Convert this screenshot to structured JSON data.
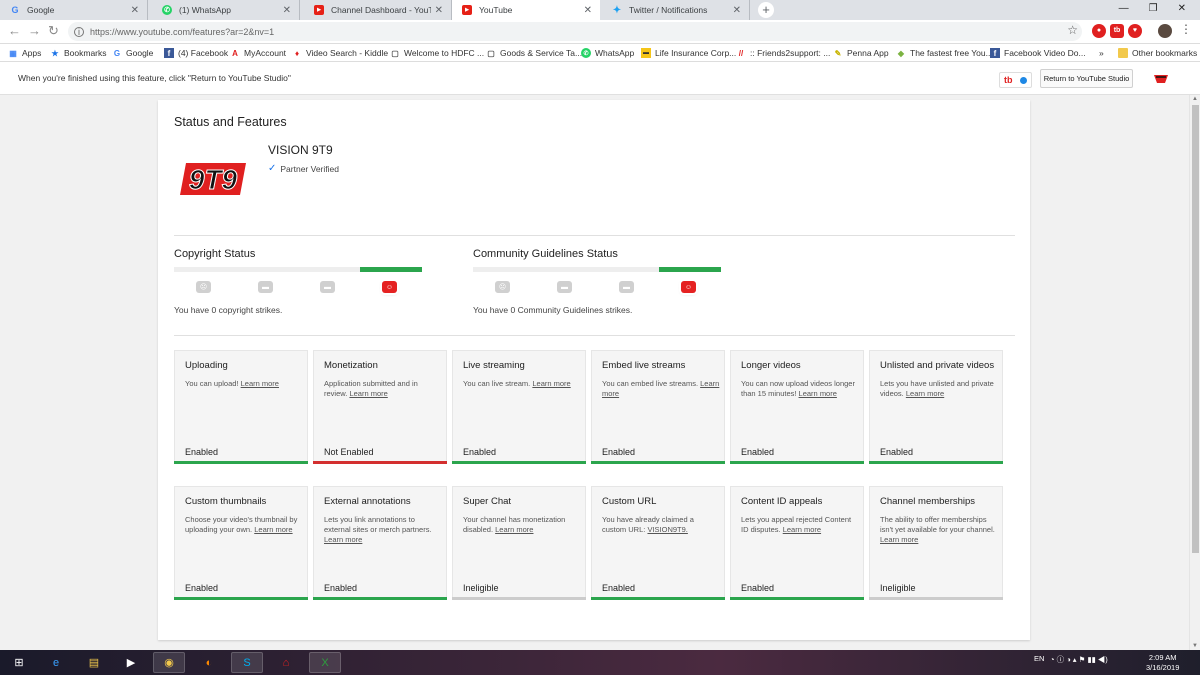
{
  "tabs": [
    {
      "title": "Google",
      "icon": "google-icon"
    },
    {
      "title": "(1) WhatsApp",
      "icon": "whatsapp-icon"
    },
    {
      "title": "Channel Dashboard - YouTube S",
      "icon": "youtube-icon"
    },
    {
      "title": "YouTube",
      "icon": "youtube-icon"
    },
    {
      "title": "Twitter / Notifications",
      "icon": "twitter-icon"
    }
  ],
  "address": {
    "url": "https://www.youtube.com/features?ar=2&nv=1"
  },
  "bookmarks": [
    "Apps",
    "Bookmarks",
    "Google",
    "(4) Facebook",
    "MyAccount",
    "Video Search - Kiddle",
    "Welcome to HDFC ...",
    "Goods & Service Ta...",
    "WhatsApp",
    "Life Insurance Corp...",
    ":: Friends2support: ...",
    "Penna App",
    "The fastest free You...",
    "Facebook Video Do..."
  ],
  "bookmarks_more": "»",
  "other_bookmarks": "Other bookmarks",
  "notice": {
    "message": "When you're finished using this feature, click \"Return to YouTube Studio\"",
    "return_label": "Return to YouTube Studio",
    "tb_label": "tb"
  },
  "page": {
    "title": "Status and Features",
    "channel_name": "VISION 9T9",
    "verified": "Partner Verified",
    "copyright": {
      "title": "Copyright Status",
      "text": "You have 0 copyright strikes.",
      "level": 0
    },
    "community": {
      "title": "Community Guidelines Status",
      "text": "You have 0 Community Guidelines strikes.",
      "level": 0
    }
  },
  "features": [
    {
      "title": "Uploading",
      "desc": "You can upload!",
      "link": "Learn more",
      "status": "Enabled",
      "color": "#2ba54d"
    },
    {
      "title": "Monetization",
      "desc": "Application submitted and in review.",
      "link": "Learn more",
      "status": "Not Enabled",
      "color": "#d32f2f"
    },
    {
      "title": "Live streaming",
      "desc": "You can live stream.",
      "link": "Learn more",
      "status": "Enabled",
      "color": "#2ba54d"
    },
    {
      "title": "Embed live streams",
      "desc": "You can embed live streams.",
      "link": "Learn more",
      "status": "Enabled",
      "color": "#2ba54d"
    },
    {
      "title": "Longer videos",
      "desc": "You can now upload videos longer than 15 minutes!",
      "link": "Learn more",
      "status": "Enabled",
      "color": "#2ba54d"
    },
    {
      "title": "Unlisted and private videos",
      "desc": "Lets you have unlisted and private videos.",
      "link": "Learn more",
      "status": "Enabled",
      "color": "#2ba54d"
    },
    {
      "title": "Custom thumbnails",
      "desc": "Choose your video's thumbnail by uploading your own.",
      "link": "Learn more",
      "status": "Enabled",
      "color": "#2ba54d"
    },
    {
      "title": "External annotations",
      "desc": "Lets you link annotations to external sites or merch partners.",
      "link": "Learn more",
      "status": "Enabled",
      "color": "#2ba54d"
    },
    {
      "title": "Super Chat",
      "desc": "Your channel has monetization disabled.",
      "link": "Learn more",
      "status": "Ineligible",
      "color": "#cccccc"
    },
    {
      "title": "Custom URL",
      "desc": "You have already claimed a custom URL:",
      "link": "VISION9T9.",
      "status": "Enabled",
      "color": "#2ba54d"
    },
    {
      "title": "Content ID appeals",
      "desc": "Lets you appeal rejected Content ID disputes.",
      "link": "Learn more",
      "status": "Enabled",
      "color": "#2ba54d"
    },
    {
      "title": "Channel memberships",
      "desc": "The ability to offer memberships isn't yet available for your channel.",
      "link": "Learn more",
      "status": "Ineligible",
      "color": "#cccccc"
    }
  ],
  "taskbar": {
    "lang": "EN",
    "time": "2:09 AM",
    "date": "3/16/2019"
  }
}
